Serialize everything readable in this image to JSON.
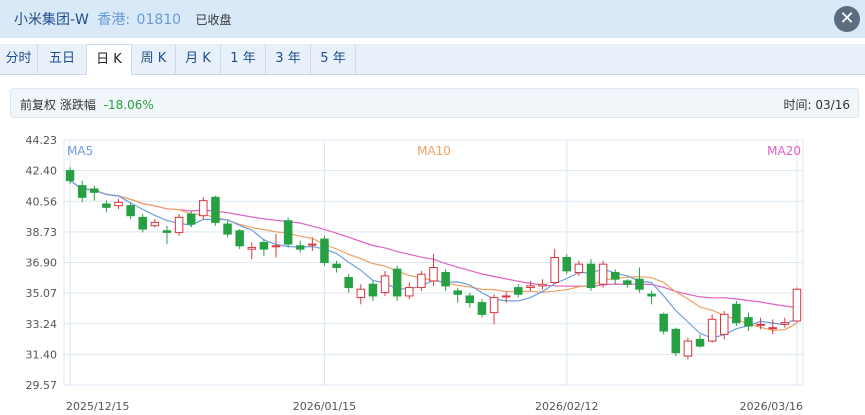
{
  "header": {
    "name": "小米集团-W",
    "market": "香港:",
    "code": "01810",
    "status": "已收盘",
    "close_symbol": "✕"
  },
  "tabs": [
    {
      "label": "分时",
      "active": false
    },
    {
      "label": "五日",
      "active": false
    },
    {
      "label": "日 K",
      "active": true
    },
    {
      "label": "周 K",
      "active": false
    },
    {
      "label": "月 K",
      "active": false
    },
    {
      "label": "1 年",
      "active": false
    },
    {
      "label": "3 年",
      "active": false
    },
    {
      "label": "5 年",
      "active": false
    }
  ],
  "info": {
    "adjust": "前复权",
    "change_label": "涨跌幅",
    "change_value": "-18.06%",
    "time_label": "时间: 03/16"
  },
  "colors": {
    "up": "#d9363e",
    "down": "#26a042",
    "ma5": "#6f9fe0",
    "ma10": "#f0a060",
    "ma20": "#e061c0",
    "grid": "#dce8f4"
  },
  "chart_data": {
    "type": "candlestick",
    "yticks": [
      "44.23",
      "42.40",
      "40.56",
      "38.73",
      "36.90",
      "35.07",
      "33.24",
      "31.40",
      "29.57"
    ],
    "ylim": [
      29.57,
      44.23
    ],
    "xticks": [
      "2025/12/15",
      "2026/01/15",
      "2026/02/12",
      "2026/03/16"
    ],
    "xtick_index": [
      0,
      21,
      41,
      60
    ],
    "legend": [
      "MA5",
      "MA10",
      "MA20"
    ],
    "candles": [
      [
        42.4,
        41.8,
        42.6,
        41.6
      ],
      [
        41.5,
        40.8,
        41.8,
        40.5
      ],
      [
        41.3,
        41.1,
        41.5,
        40.6
      ],
      [
        40.4,
        40.2,
        40.6,
        39.9
      ],
      [
        40.3,
        40.5,
        40.7,
        40.1
      ],
      [
        40.3,
        39.7,
        40.5,
        39.5
      ],
      [
        39.6,
        38.9,
        39.8,
        38.7
      ],
      [
        39.1,
        39.3,
        39.5,
        39.0
      ],
      [
        38.8,
        38.7,
        39.1,
        38.0
      ],
      [
        38.7,
        39.6,
        39.8,
        38.5
      ],
      [
        39.8,
        39.2,
        40.0,
        39.0
      ],
      [
        39.7,
        40.6,
        40.8,
        39.5
      ],
      [
        40.8,
        39.3,
        40.9,
        39.1
      ],
      [
        39.2,
        38.6,
        39.4,
        38.4
      ],
      [
        38.8,
        37.9,
        38.9,
        37.7
      ],
      [
        37.7,
        37.8,
        38.1,
        37.1
      ],
      [
        38.1,
        37.7,
        38.3,
        37.3
      ],
      [
        37.9,
        37.9,
        38.6,
        37.2
      ],
      [
        39.4,
        38.0,
        39.6,
        37.8
      ],
      [
        37.9,
        37.7,
        38.2,
        37.5
      ],
      [
        38.0,
        38.0,
        38.4,
        37.6
      ],
      [
        38.3,
        36.9,
        38.5,
        36.7
      ],
      [
        36.8,
        36.6,
        37.0,
        36.3
      ],
      [
        36.0,
        35.4,
        36.2,
        35.1
      ],
      [
        34.8,
        35.3,
        35.6,
        34.4
      ],
      [
        35.6,
        34.9,
        35.8,
        34.6
      ],
      [
        35.1,
        36.1,
        36.4,
        34.9
      ],
      [
        36.5,
        34.9,
        36.7,
        34.6
      ],
      [
        34.9,
        35.4,
        35.7,
        34.7
      ],
      [
        35.4,
        36.2,
        36.4,
        35.2
      ],
      [
        35.8,
        36.6,
        37.4,
        35.5
      ],
      [
        36.3,
        35.5,
        36.5,
        35.2
      ],
      [
        35.2,
        35.0,
        35.4,
        34.5
      ],
      [
        34.9,
        34.5,
        35.1,
        34.2
      ],
      [
        34.5,
        33.8,
        34.7,
        33.6
      ],
      [
        33.9,
        34.8,
        35.0,
        33.2
      ],
      [
        34.9,
        34.9,
        35.1,
        34.5
      ],
      [
        35.4,
        35.0,
        35.6,
        34.8
      ],
      [
        35.4,
        35.5,
        35.8,
        35.2
      ],
      [
        35.5,
        35.6,
        35.9,
        35.3
      ],
      [
        35.7,
        37.2,
        37.7,
        35.6
      ],
      [
        37.2,
        36.4,
        37.4,
        36.2
      ],
      [
        36.3,
        36.8,
        37.0,
        36.1
      ],
      [
        36.8,
        35.4,
        37.1,
        35.2
      ],
      [
        35.6,
        36.8,
        37.0,
        35.4
      ],
      [
        36.3,
        35.9,
        36.5,
        35.6
      ],
      [
        35.8,
        35.6,
        35.9,
        35.4
      ],
      [
        35.9,
        35.3,
        36.6,
        35.1
      ],
      [
        35.0,
        34.9,
        35.2,
        34.4
      ],
      [
        33.8,
        32.8,
        33.9,
        32.6
      ],
      [
        32.9,
        31.5,
        33.0,
        31.3
      ],
      [
        31.3,
        32.2,
        32.4,
        31.1
      ],
      [
        32.3,
        31.9,
        32.6,
        31.8
      ],
      [
        32.2,
        33.5,
        33.8,
        32.1
      ],
      [
        32.6,
        33.8,
        34.0,
        32.3
      ],
      [
        34.4,
        33.3,
        34.6,
        33.1
      ],
      [
        33.6,
        33.1,
        33.9,
        32.8
      ],
      [
        33.2,
        33.2,
        33.6,
        32.9
      ],
      [
        33.0,
        33.0,
        33.5,
        32.6
      ],
      [
        33.2,
        33.3,
        33.6,
        33.0
      ],
      [
        33.4,
        35.3,
        35.4,
        33.3
      ]
    ]
  }
}
